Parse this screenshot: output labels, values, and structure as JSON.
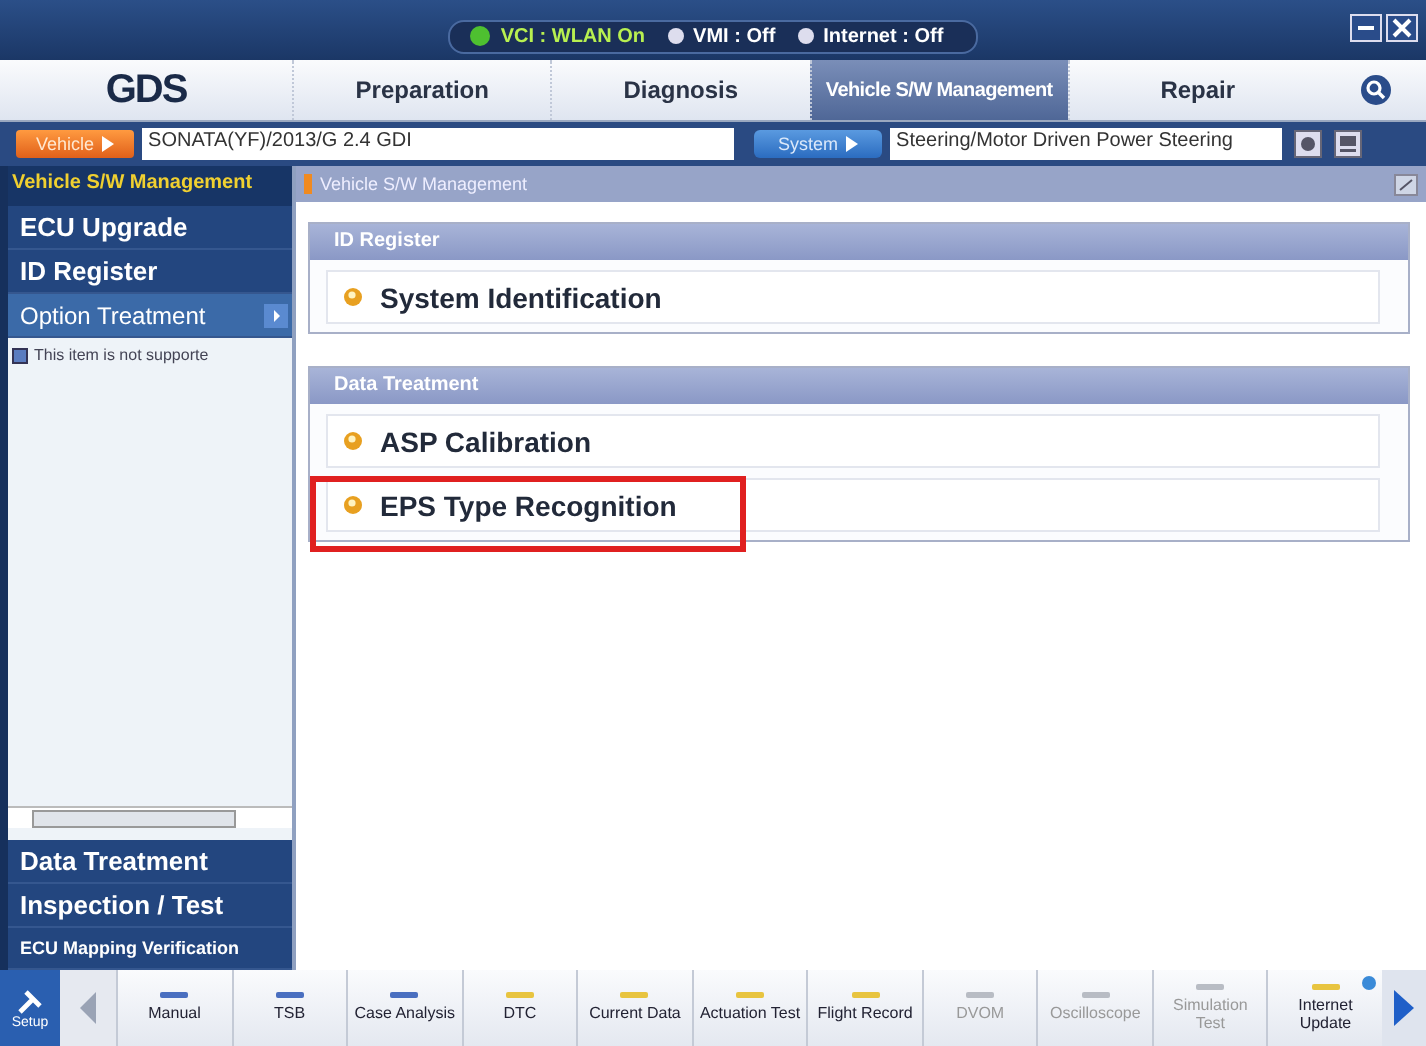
{
  "status": [
    {
      "label": "VCI : WLAN On",
      "on": true
    },
    {
      "label": "VMI : Off",
      "on": false
    },
    {
      "label": "Internet : Off",
      "on": false
    }
  ],
  "logo": "GDS",
  "tabs": [
    {
      "label": "Preparation",
      "selected": false
    },
    {
      "label": "Diagnosis",
      "selected": false
    },
    {
      "label": "Vehicle S/W Management",
      "selected": true
    },
    {
      "label": "Repair",
      "selected": false
    }
  ],
  "vehicle": {
    "button": "Vehicle",
    "value": "SONATA(YF)/2013/G 2.4 GDI"
  },
  "system": {
    "button": "System",
    "value": "Steering/Motor Driven Power Steering"
  },
  "sidebar": {
    "title": "Vehicle S/W Management",
    "items": [
      {
        "label": "ECU Upgrade",
        "selected": false
      },
      {
        "label": "ID Register",
        "selected": false
      },
      {
        "label": "Option Treatment",
        "selected": true
      }
    ],
    "note": "This item is not supporte",
    "bottom_items": [
      {
        "label": "Data Treatment",
        "selected": false
      },
      {
        "label": "Inspection / Test",
        "selected": false
      },
      {
        "label": "ECU Mapping Verification",
        "selected": false
      }
    ]
  },
  "breadcrumb": "Vehicle S/W Management",
  "sections": [
    {
      "title": "ID Register",
      "items": [
        {
          "label": "System Identification",
          "highlighted": false
        }
      ]
    },
    {
      "title": "Data Treatment",
      "items": [
        {
          "label": "ASP Calibration",
          "highlighted": false
        },
        {
          "label": "EPS Type Recognition",
          "highlighted": true
        }
      ]
    }
  ],
  "toolbar": {
    "setup": "Setup",
    "items": [
      {
        "label": "Manual",
        "color": "#4a6fc0",
        "disabled": false
      },
      {
        "label": "TSB",
        "color": "#4a6fc0",
        "disabled": false
      },
      {
        "label": "Case Analysis",
        "color": "#4a6fc0",
        "disabled": false
      },
      {
        "label": "DTC",
        "color": "#e8c440",
        "disabled": false
      },
      {
        "label": "Current Data",
        "color": "#e8c440",
        "disabled": false
      },
      {
        "label": "Actuation Test",
        "color": "#e8c440",
        "disabled": false
      },
      {
        "label": "Flight Record",
        "color": "#e8c440",
        "disabled": false
      },
      {
        "label": "DVOM",
        "color": "#b8bcc4",
        "disabled": true
      },
      {
        "label": "Oscilloscope",
        "color": "#b8bcc4",
        "disabled": true
      },
      {
        "label": "Simulation Test",
        "color": "#b8bcc4",
        "disabled": true
      },
      {
        "label": "Internet Update",
        "color": "#e8c440",
        "disabled": false,
        "badge": true
      }
    ]
  }
}
